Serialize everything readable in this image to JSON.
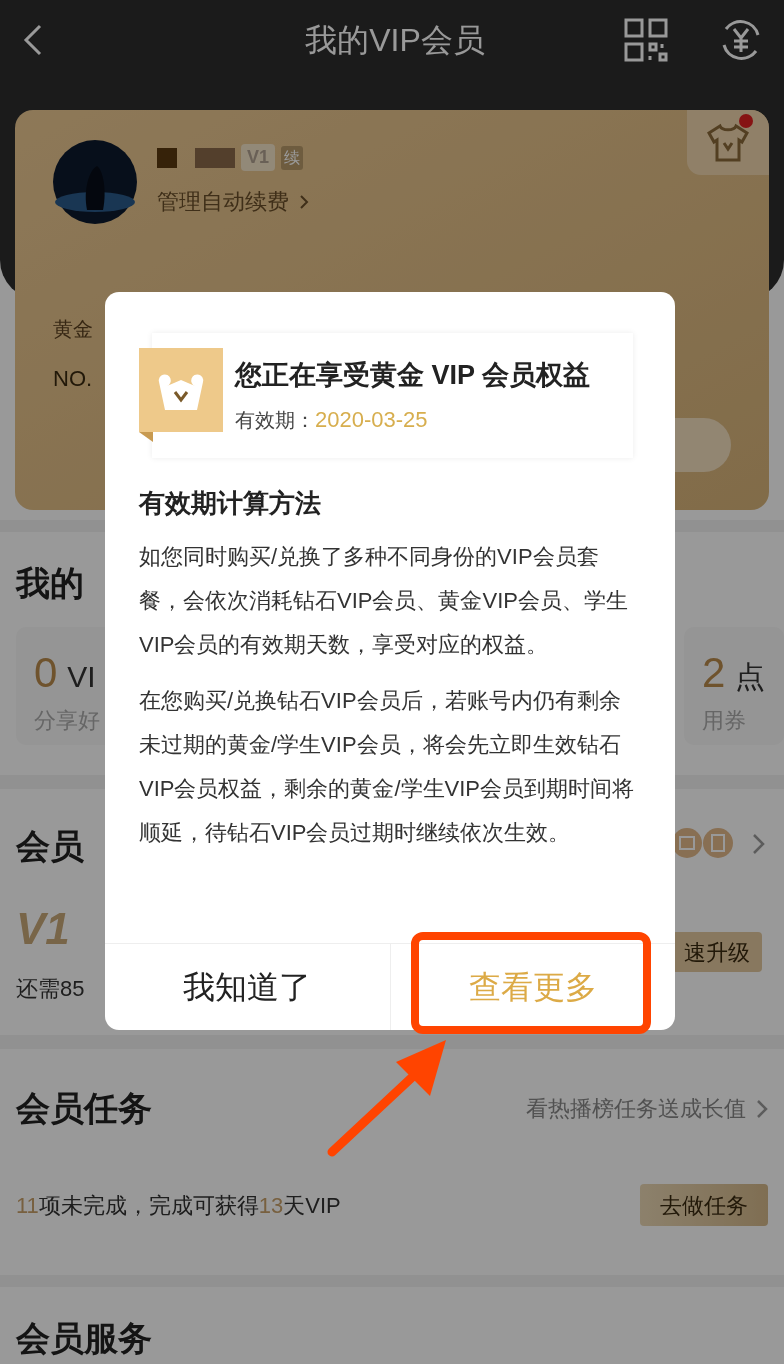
{
  "header": {
    "title": "我的VIP会员"
  },
  "card": {
    "level_badge": "V1",
    "renew_badge": "续",
    "manage": "管理自动续费",
    "card_type": "黄金",
    "card_no": "NO.",
    "has_notice": true
  },
  "assets": {
    "title": "我的",
    "items": [
      {
        "value": "0",
        "unit": "VI",
        "desc": "分享好"
      },
      {
        "value": "2",
        "unit": "点",
        "desc": "用券"
      }
    ]
  },
  "level": {
    "title": "会员",
    "level": "V1",
    "need": "还需85",
    "upgrade_button": "速升级"
  },
  "tasks": {
    "title": "会员任务",
    "link": "看热播榜任务送成长值",
    "summary": [
      {
        "text": "11",
        "highlight": true
      },
      {
        "text": "项未完成，完成可获得",
        "highlight": false
      },
      {
        "text": "13",
        "highlight": true
      },
      {
        "text": "天VIP",
        "highlight": false
      }
    ],
    "button": "去做任务"
  },
  "services": {
    "title": "会员服务"
  },
  "modal": {
    "title": "您正在享受黄金 VIP 会员权益",
    "validity_label": "有效期：",
    "validity_date": "2020-03-25",
    "section_title": "有效期计算方法",
    "paragraphs": [
      "如您同时购买/兑换了多种不同身份的VIP会员套餐，会依次消耗钻石VIP会员、黄金VIP会员、学生VIP会员的有效期天数，享受对应的权益。",
      "在您购买/兑换钻石VIP会员后，若账号内仍有剩余未过期的黄金/学生VIP会员，将会先立即生效钻石VIP会员权益，剩余的黄金/学生VIP会员到期时间将顺延，待钻石VIP会员过期时继续依次生效。"
    ],
    "buttons": [
      {
        "label": "我知道了",
        "primary": false,
        "annotated": false
      },
      {
        "label": "查看更多",
        "primary": true,
        "annotated": true
      }
    ]
  }
}
